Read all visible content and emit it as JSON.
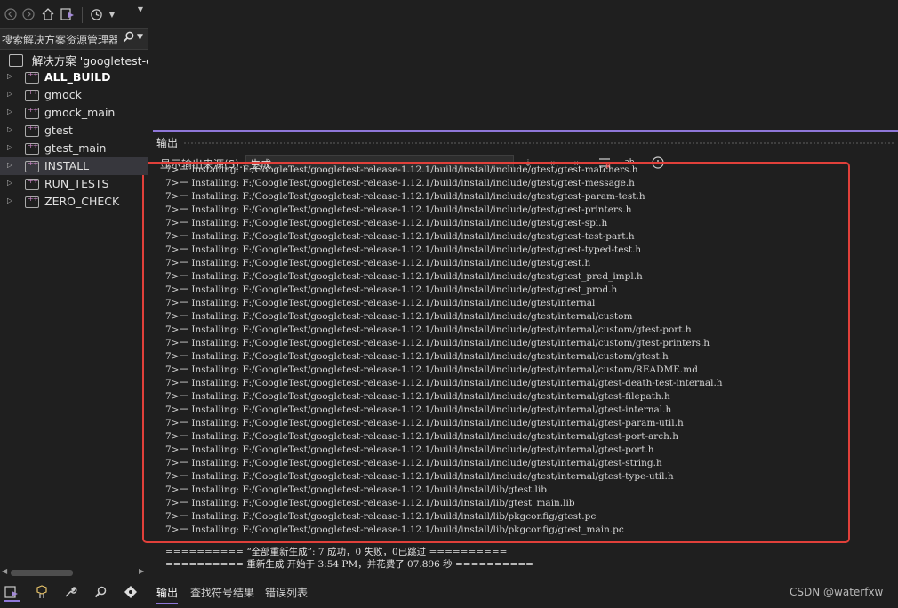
{
  "toolbar": {
    "icons": [
      "back-icon",
      "forward-icon",
      "home-icon",
      "switch-view-icon",
      "history-icon"
    ]
  },
  "search": {
    "text": "搜索解决方案资源管理器"
  },
  "solution": {
    "label": "解决方案 'googletest-di"
  },
  "tree": {
    "items": [
      {
        "label": "ALL_BUILD",
        "bold": true,
        "selected": false
      },
      {
        "label": "gmock",
        "bold": false,
        "selected": false
      },
      {
        "label": "gmock_main",
        "bold": false,
        "selected": false
      },
      {
        "label": "gtest",
        "bold": false,
        "selected": false
      },
      {
        "label": "gtest_main",
        "bold": false,
        "selected": false
      },
      {
        "label": "INSTALL",
        "bold": false,
        "selected": true
      },
      {
        "label": "RUN_TESTS",
        "bold": false,
        "selected": false
      },
      {
        "label": "ZERO_CHECK",
        "bold": false,
        "selected": false
      }
    ]
  },
  "output": {
    "title": "输出",
    "source_label": "显示输出来源(S):",
    "source_value": "生成",
    "lines": [
      "7>一 Installing: F:/GoogleTest/googletest-release-1.12.1/build/install/include/gtest/gtest-matchers.h",
      "7>一 Installing: F:/GoogleTest/googletest-release-1.12.1/build/install/include/gtest/gtest-message.h",
      "7>一 Installing: F:/GoogleTest/googletest-release-1.12.1/build/install/include/gtest/gtest-param-test.h",
      "7>一 Installing: F:/GoogleTest/googletest-release-1.12.1/build/install/include/gtest/gtest-printers.h",
      "7>一 Installing: F:/GoogleTest/googletest-release-1.12.1/build/install/include/gtest/gtest-spi.h",
      "7>一 Installing: F:/GoogleTest/googletest-release-1.12.1/build/install/include/gtest/gtest-test-part.h",
      "7>一 Installing: F:/GoogleTest/googletest-release-1.12.1/build/install/include/gtest/gtest-typed-test.h",
      "7>一 Installing: F:/GoogleTest/googletest-release-1.12.1/build/install/include/gtest/gtest.h",
      "7>一 Installing: F:/GoogleTest/googletest-release-1.12.1/build/install/include/gtest/gtest_pred_impl.h",
      "7>一 Installing: F:/GoogleTest/googletest-release-1.12.1/build/install/include/gtest/gtest_prod.h",
      "7>一 Installing: F:/GoogleTest/googletest-release-1.12.1/build/install/include/gtest/internal",
      "7>一 Installing: F:/GoogleTest/googletest-release-1.12.1/build/install/include/gtest/internal/custom",
      "7>一 Installing: F:/GoogleTest/googletest-release-1.12.1/build/install/include/gtest/internal/custom/gtest-port.h",
      "7>一 Installing: F:/GoogleTest/googletest-release-1.12.1/build/install/include/gtest/internal/custom/gtest-printers.h",
      "7>一 Installing: F:/GoogleTest/googletest-release-1.12.1/build/install/include/gtest/internal/custom/gtest.h",
      "7>一 Installing: F:/GoogleTest/googletest-release-1.12.1/build/install/include/gtest/internal/custom/README.md",
      "7>一 Installing: F:/GoogleTest/googletest-release-1.12.1/build/install/include/gtest/internal/gtest-death-test-internal.h",
      "7>一 Installing: F:/GoogleTest/googletest-release-1.12.1/build/install/include/gtest/internal/gtest-filepath.h",
      "7>一 Installing: F:/GoogleTest/googletest-release-1.12.1/build/install/include/gtest/internal/gtest-internal.h",
      "7>一 Installing: F:/GoogleTest/googletest-release-1.12.1/build/install/include/gtest/internal/gtest-param-util.h",
      "7>一 Installing: F:/GoogleTest/googletest-release-1.12.1/build/install/include/gtest/internal/gtest-port-arch.h",
      "7>一 Installing: F:/GoogleTest/googletest-release-1.12.1/build/install/include/gtest/internal/gtest-port.h",
      "7>一 Installing: F:/GoogleTest/googletest-release-1.12.1/build/install/include/gtest/internal/gtest-string.h",
      "7>一 Installing: F:/GoogleTest/googletest-release-1.12.1/build/install/include/gtest/internal/gtest-type-util.h",
      "7>一 Installing: F:/GoogleTest/googletest-release-1.12.1/build/install/lib/gtest.lib",
      "7>一 Installing: F:/GoogleTest/googletest-release-1.12.1/build/install/lib/gtest_main.lib",
      "7>一 Installing: F:/GoogleTest/googletest-release-1.12.1/build/install/lib/pkgconfig/gtest.pc",
      "7>一 Installing: F:/GoogleTest/googletest-release-1.12.1/build/install/lib/pkgconfig/gtest_main.pc"
    ],
    "summary1": "========== “全部重新生成”: 7 成功，0 失败，0已跳过 ==========",
    "summary2": "========== 重新生成 开始于 3:54 PM，并花费了 07.896 秒 =========="
  },
  "tabs": {
    "output": "输出",
    "find_symbol": "查找符号结果",
    "error_list": "错误列表"
  },
  "watermark": "CSDN @waterfxw",
  "colors": {
    "accent": "#8f77d8",
    "highlight_box": "#e0403a",
    "background": "#1f1f1f"
  }
}
